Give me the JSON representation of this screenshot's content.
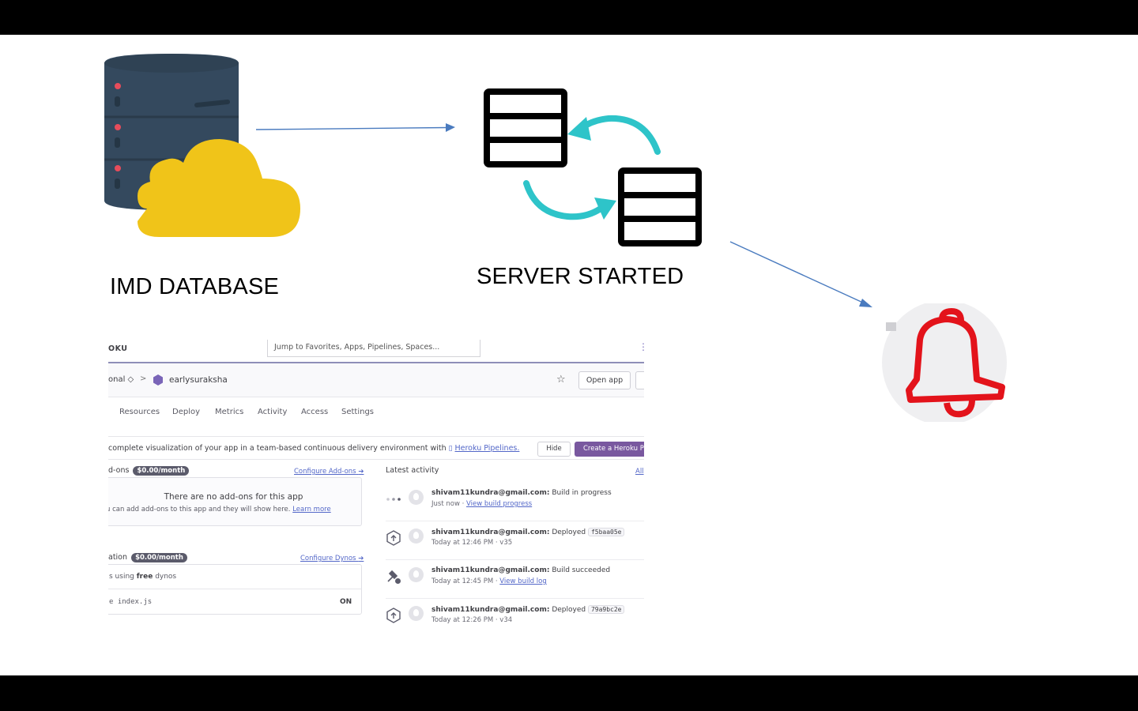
{
  "diagram": {
    "database_label": "IMD DATABASE",
    "server_label": "SERVER STARTED",
    "colors": {
      "cloud": "#f0c419",
      "db_body": "#34495e",
      "sync_arrows": "#2ec4c9",
      "arrows": "#4a7bbf",
      "bell": "#e3131b"
    },
    "icons": [
      "database-icon",
      "cloud-icon",
      "server-icon",
      "sync-arrow-icon",
      "bell-icon"
    ]
  },
  "heroku": {
    "logo": "OKU",
    "search_placeholder": "Jump to Favorites, Apps, Pipelines, Spaces...",
    "team": "onal ◇",
    "breadcrumb_sep": ">",
    "app_name": "earlysuraksha",
    "open_app": "Open app",
    "tabs": [
      "Resources",
      "Deploy",
      "Metrics",
      "Activity",
      "Access",
      "Settings"
    ],
    "banner": {
      "text": "complete visualization of your app in a team-based continuous delivery environment with",
      "link": "Heroku Pipelines.",
      "hide": "Hide",
      "create": "Create a Heroku Pi"
    },
    "addons": {
      "title": "d-ons",
      "price": "$0.00/month",
      "configure": "Configure Add-ons",
      "empty_title": "There are no add-ons for this app",
      "empty_sub": "u can add add-ons to this app and they will show here.",
      "learn_more": "Learn more"
    },
    "dynos": {
      "title": "ation",
      "price": "$0.00/month",
      "configure": "Configure Dynos",
      "usage_prefix": "s using",
      "usage_bold": "free",
      "usage_suffix": "dynos",
      "process_prefix": "e",
      "process_cmd": "index.js",
      "process_state": "ON"
    },
    "activity": {
      "title": "Latest activity",
      "all": "All",
      "items": [
        {
          "user": "shivam11kundra@gmail.com:",
          "action": "Build in progress",
          "sha": "",
          "time": "Just now ·",
          "link": "View build progress",
          "icon": "dots-icon"
        },
        {
          "user": "shivam11kundra@gmail.com:",
          "action": "Deployed",
          "sha": "f5baa05e",
          "time": "Today at 12:46 PM · v35",
          "link": "",
          "icon": "deploy-icon"
        },
        {
          "user": "shivam11kundra@gmail.com:",
          "action": "Build succeeded",
          "sha": "",
          "time": "Today at 12:45 PM ·",
          "link": "View build log",
          "icon": "build-icon"
        },
        {
          "user": "shivam11kundra@gmail.com:",
          "action": "Deployed",
          "sha": "79a9bc2e",
          "time": "Today at 12:26 PM · v34",
          "link": "",
          "icon": "deploy-icon"
        }
      ]
    }
  }
}
